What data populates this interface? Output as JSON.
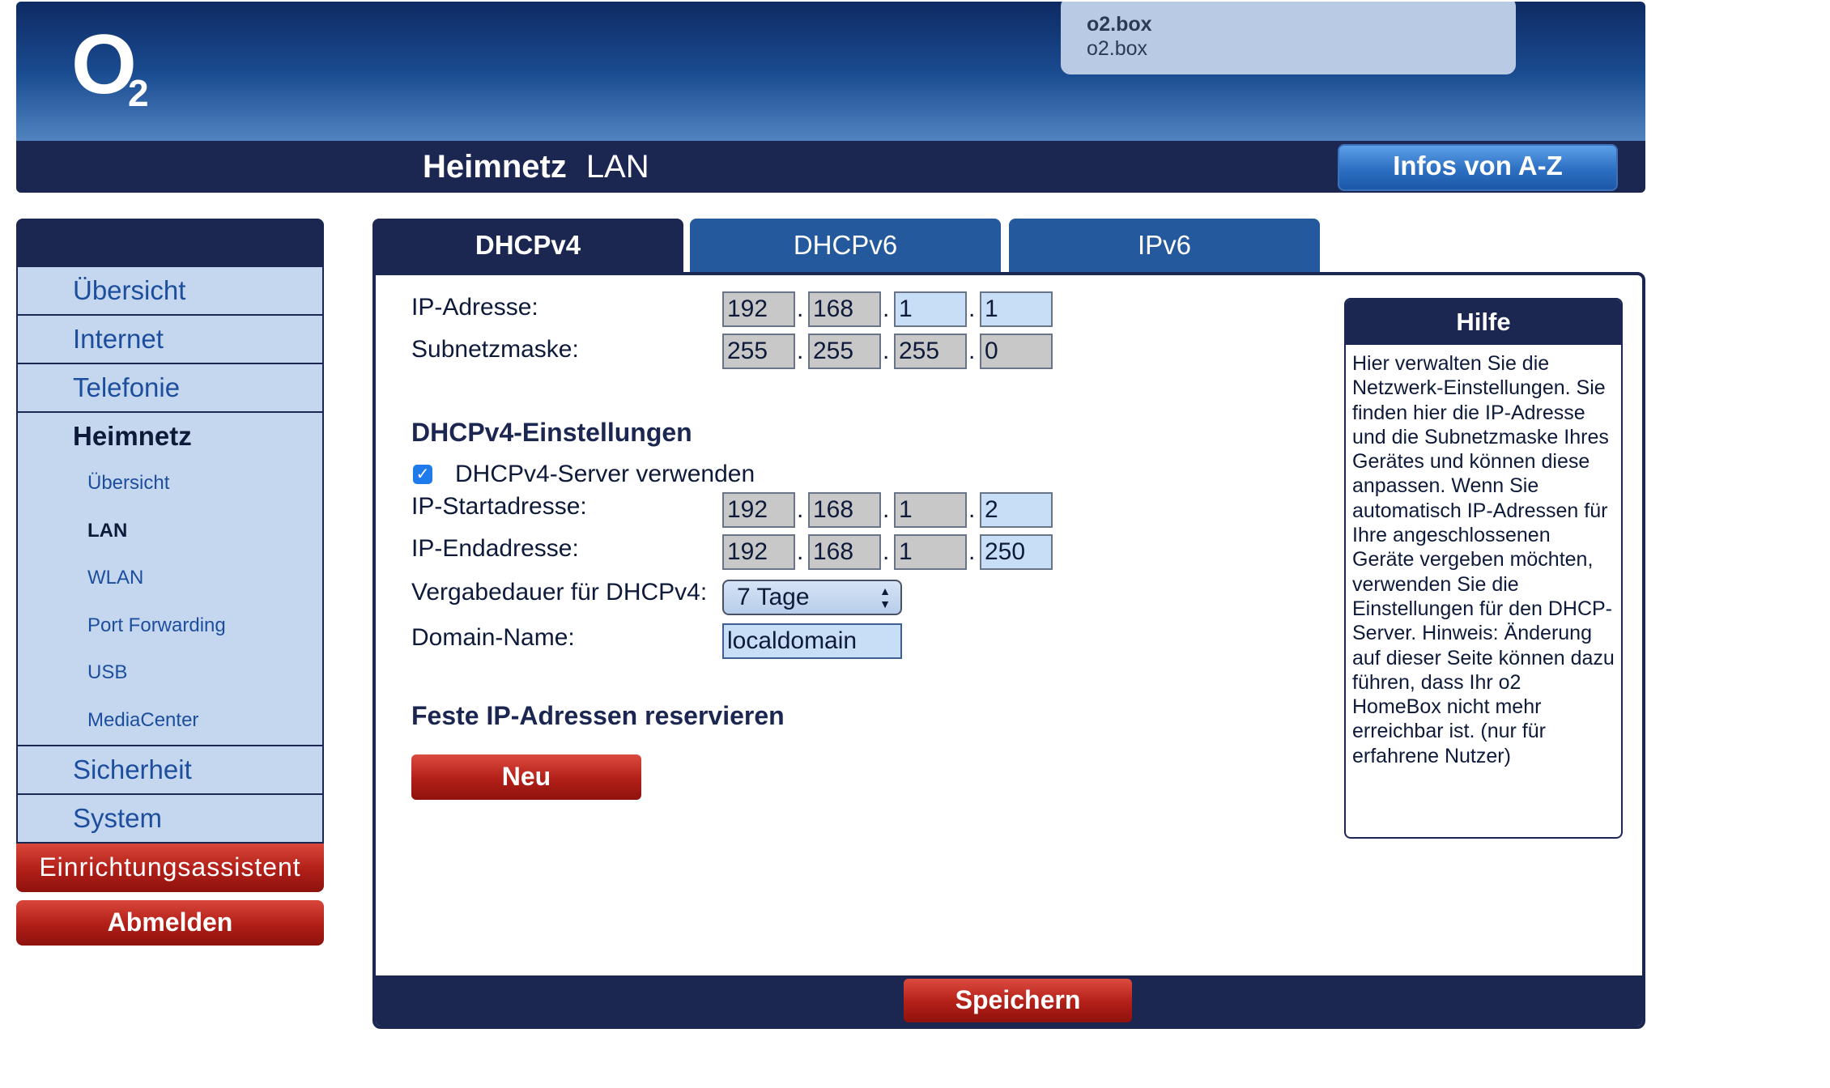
{
  "header": {
    "logo": {
      "o": "O",
      "sub": "2"
    },
    "device": {
      "line1": "o2.box",
      "line2": "o2.box"
    },
    "title_bold": "Heimnetz",
    "title_rest": "LAN",
    "infos_label": "Infos von A-Z"
  },
  "sidebar": {
    "main_items": [
      {
        "label": "Übersicht"
      },
      {
        "label": "Internet"
      },
      {
        "label": "Telefonie"
      },
      {
        "label": "Heimnetz",
        "active": true
      }
    ],
    "sub_items": [
      {
        "label": "Übersicht"
      },
      {
        "label": "LAN",
        "active": true
      },
      {
        "label": "WLAN"
      },
      {
        "label": "Port Forwarding"
      },
      {
        "label": "USB"
      },
      {
        "label": "MediaCenter"
      }
    ],
    "bottom_items": [
      {
        "label": "Sicherheit"
      },
      {
        "label": "System"
      }
    ],
    "assistant_label": "Einrichtungsassistent",
    "logout_label": "Abmelden"
  },
  "tabs": [
    {
      "label": "DHCPv4",
      "active": true
    },
    {
      "label": "DHCPv6"
    },
    {
      "label": "IPv6"
    }
  ],
  "form": {
    "ip_address": {
      "label": "IP-Adresse:",
      "octets": [
        "192",
        "168",
        "1",
        "1"
      ]
    },
    "subnet_mask": {
      "label": "Subnetzmaske:",
      "octets": [
        "255",
        "255",
        "255",
        "0"
      ]
    },
    "dhcp_section_title": "DHCPv4-Einstellungen",
    "dhcp_server": {
      "label": "DHCPv4-Server verwenden",
      "checked": true,
      "check_glyph": "✓"
    },
    "start_address": {
      "label": "IP-Startadresse:",
      "octets": [
        "192",
        "168",
        "1",
        "2"
      ]
    },
    "end_address": {
      "label": "IP-Endadresse:",
      "octets": [
        "192",
        "168",
        "1",
        "250"
      ]
    },
    "lease": {
      "label": "Vergabedauer für DHCPv4:",
      "value": "7 Tage"
    },
    "domain": {
      "label": "Domain-Name:",
      "value": "localdomain"
    },
    "reserve_section_title": "Feste IP-Adressen reservieren",
    "new_label": "Neu",
    "save_label": "Speichern"
  },
  "help": {
    "title": "Hilfe",
    "text": "Hier verwalten Sie die Netzwerk-Einstellungen. Sie finden hier die IP-Adresse und die Subnetzmaske Ihres Gerätes und können diese anpassen. Wenn Sie automatisch IP-Adressen für Ihre angeschlossenen Geräte vergeben möchten, verwenden Sie die Einstellungen für den DHCP-Server. Hinweis: Änderung auf dieser Seite können dazu führen, dass Ihr o2 HomeBox nicht mehr erreichbar ist. (nur für erfahrene Nutzer)"
  },
  "colors": {
    "navy": "#1b2751",
    "tab_blue": "#24599e",
    "menu_bg": "#c4d7ee",
    "field_editable": "#c8ddf6",
    "field_readonly": "#c8c8c8",
    "button_red": "#b01e17"
  }
}
